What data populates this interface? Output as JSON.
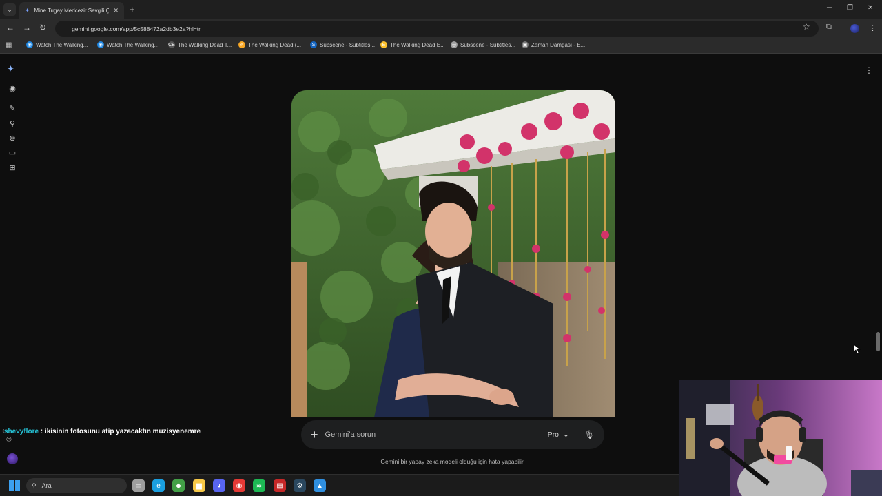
{
  "browser": {
    "active_tab_title": "Mine Tugay Medcezir Sevgili Ç",
    "url": "gemini.google.com/app/5c588472a2db3e2a?hl=tr"
  },
  "bookmarks": [
    {
      "label": "Watch The Walking...",
      "color": "#1e88e5",
      "glyph": "◉"
    },
    {
      "label": "Watch The Walking...",
      "color": "#1e88e5",
      "glyph": "◉"
    },
    {
      "label": "The Walking Dead T...",
      "color": "#555555",
      "glyph": "CE"
    },
    {
      "label": "The Walking Dead (...",
      "color": "#f9a825",
      "glyph": "✐"
    },
    {
      "label": "Subscene - Subtitles...",
      "color": "#1565c0",
      "glyph": "S"
    },
    {
      "label": "The Walking Dead E...",
      "color": "#fbc02d",
      "glyph": "E"
    },
    {
      "label": "Subscene - Subtitles...",
      "color": "#9e9e9e",
      "glyph": "◎"
    },
    {
      "label": "Zaman Damgası - E...",
      "color": "#757575",
      "glyph": "▣"
    }
  ],
  "gemini": {
    "prompt_placeholder": "Gemini'a sorun",
    "model_label": "Pro",
    "disclaimer": "Gemini bir yapay zeka modeli olduğu için hata yapabilir."
  },
  "chat": {
    "username": "shevyflore",
    "separator": " : ",
    "message": "ikisinin fotosunu atip yazacaktın muzisyenemre"
  },
  "taskbar": {
    "search_label": "Ara",
    "apps": [
      {
        "name": "task-view",
        "color": "#9e9e9e",
        "glyph": "▭"
      },
      {
        "name": "edge",
        "color": "#1a9fe0",
        "glyph": "e"
      },
      {
        "name": "vpn",
        "color": "#43a047",
        "glyph": "◆"
      },
      {
        "name": "file-explorer",
        "color": "#f7c948",
        "glyph": "▆"
      },
      {
        "name": "discord",
        "color": "#5865f2",
        "glyph": "◕"
      },
      {
        "name": "chrome",
        "color": "#e53935",
        "glyph": "◉"
      },
      {
        "name": "spotify",
        "color": "#1db954",
        "glyph": "≋"
      },
      {
        "name": "recorder",
        "color": "#c62828",
        "glyph": "▤"
      },
      {
        "name": "steam",
        "color": "#2a475e",
        "glyph": "⚙"
      },
      {
        "name": "photos",
        "color": "#2f8fe0",
        "glyph": "▲"
      }
    ]
  },
  "colors": {
    "accent": "#8ab4f8",
    "chat_username": "#26c6da"
  }
}
